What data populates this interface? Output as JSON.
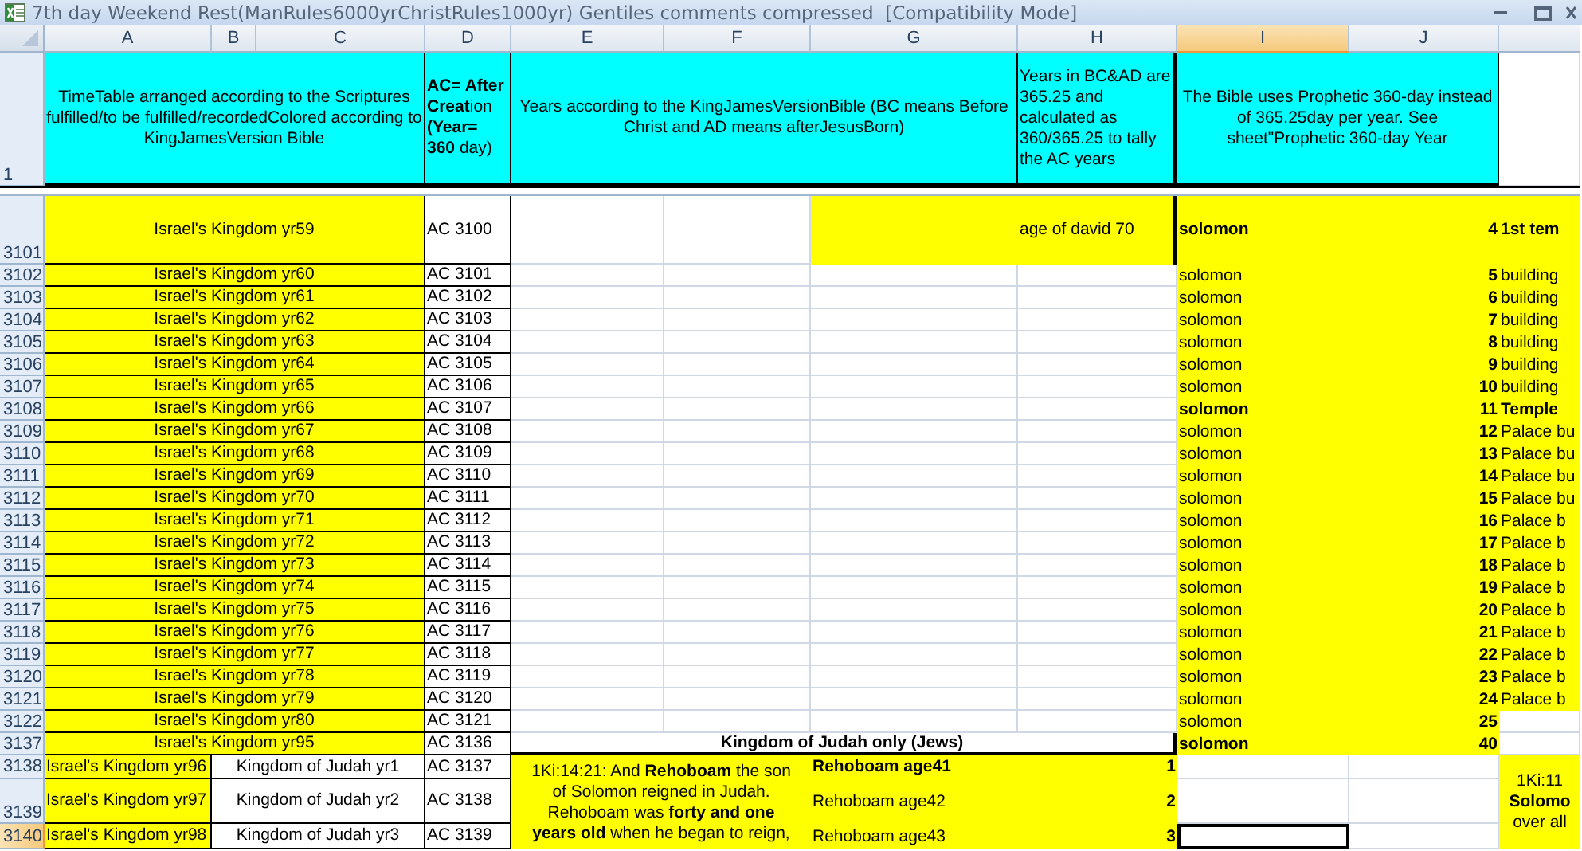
{
  "window": {
    "title": "7th day Weekend Rest(ManRules6000yrChristRules1000yr) Gentiles comments compressed  [Compatibility Mode]"
  },
  "columns": [
    {
      "label": "A",
      "selected": false
    },
    {
      "label": "B",
      "selected": false
    },
    {
      "label": "C",
      "selected": false
    },
    {
      "label": "D",
      "selected": false
    },
    {
      "label": "E",
      "selected": false
    },
    {
      "label": "F",
      "selected": false
    },
    {
      "label": "G",
      "selected": false
    },
    {
      "label": "H",
      "selected": false
    },
    {
      "label": "I",
      "selected": true
    },
    {
      "label": "J",
      "selected": false
    }
  ],
  "rows": [
    {
      "number": "1",
      "selected": false,
      "cells": {
        "A:C": {
          "text": "TimeTable arranged according to the Scriptures fulfilled/to be fulfilled/recordedColored according to KingJamesVersion Bible",
          "color": "#00ffff"
        },
        "D": {
          "text": "**AC= After Creat**ion **(Year= 360** day)",
          "color": "#00ffff"
        },
        "E:G": {
          "text": "Years according to the KingJamesVersionBible (BC means Before Christ and AD means afterJesusBorn)",
          "color": "#00ffff"
        },
        "H": {
          "text": "Years in BC&AD are 365.25 and calculated as 360/365.25 to tally the AC years",
          "color": "#00ffff"
        },
        "I:J": {
          "text": "The Bible uses Prophetic 360-day instead of 365.25day per year. See sheet\"Prophetic 360-day Year",
          "color": "#00ffff"
        }
      }
    },
    {
      "number": "3101",
      "selected": false,
      "cells": {
        "A:C": {
          "text": "Israel's Kingdom yr59",
          "color": "#ffff00"
        },
        "D": {
          "text": "AC 3100"
        },
        "G": {
          "color": "#ffff00"
        },
        "H": {
          "text": "age of david 70",
          "color": "#ffff00"
        },
        "I": {
          "text": "solomon",
          "color": "#ffff00",
          "bold": true
        },
        "J": {
          "text": "4",
          "color": "#ffff00",
          "bold": true
        },
        "K": {
          "text": "1st tem",
          "color": "#ffff00",
          "bold": true
        }
      }
    },
    {
      "number": "3102",
      "selected": false,
      "cells": {
        "A:C": {
          "text": "Israel's Kingdom yr60",
          "color": "#ffff00"
        },
        "D": {
          "text": "AC 3101"
        },
        "I": {
          "text": "solomon",
          "color": "#ffff00",
          "bold": false
        },
        "J": {
          "text": "5",
          "color": "#ffff00",
          "bold": true
        },
        "K": {
          "text": "building",
          "color": "#ffff00",
          "bold": false
        }
      }
    },
    {
      "number": "3103",
      "selected": false,
      "cells": {
        "A:C": {
          "text": "Israel's Kingdom yr61",
          "color": "#ffff00"
        },
        "D": {
          "text": "AC 3102"
        },
        "I": {
          "text": "solomon",
          "color": "#ffff00",
          "bold": false
        },
        "J": {
          "text": "6",
          "color": "#ffff00",
          "bold": true
        },
        "K": {
          "text": "building",
          "color": "#ffff00",
          "bold": false
        }
      }
    },
    {
      "number": "3104",
      "selected": false,
      "cells": {
        "A:C": {
          "text": "Israel's Kingdom yr62",
          "color": "#ffff00"
        },
        "D": {
          "text": "AC 3103"
        },
        "I": {
          "text": "solomon",
          "color": "#ffff00",
          "bold": false
        },
        "J": {
          "text": "7",
          "color": "#ffff00",
          "bold": true
        },
        "K": {
          "text": "building",
          "color": "#ffff00",
          "bold": false
        }
      }
    },
    {
      "number": "3105",
      "selected": false,
      "cells": {
        "A:C": {
          "text": "Israel's Kingdom yr63",
          "color": "#ffff00"
        },
        "D": {
          "text": "AC 3104"
        },
        "I": {
          "text": "solomon",
          "color": "#ffff00",
          "bold": false
        },
        "J": {
          "text": "8",
          "color": "#ffff00",
          "bold": true
        },
        "K": {
          "text": "building",
          "color": "#ffff00",
          "bold": false
        }
      }
    },
    {
      "number": "3106",
      "selected": false,
      "cells": {
        "A:C": {
          "text": "Israel's Kingdom yr64",
          "color": "#ffff00"
        },
        "D": {
          "text": "AC 3105"
        },
        "I": {
          "text": "solomon",
          "color": "#ffff00",
          "bold": false
        },
        "J": {
          "text": "9",
          "color": "#ffff00",
          "bold": true
        },
        "K": {
          "text": "building",
          "color": "#ffff00",
          "bold": false
        }
      }
    },
    {
      "number": "3107",
      "selected": false,
      "cells": {
        "A:C": {
          "text": "Israel's Kingdom yr65",
          "color": "#ffff00"
        },
        "D": {
          "text": "AC 3106"
        },
        "I": {
          "text": "solomon",
          "color": "#ffff00",
          "bold": false
        },
        "J": {
          "text": "10",
          "color": "#ffff00",
          "bold": true
        },
        "K": {
          "text": "building",
          "color": "#ffff00",
          "bold": false
        }
      }
    },
    {
      "number": "3108",
      "selected": false,
      "cells": {
        "A:C": {
          "text": "Israel's Kingdom yr66",
          "color": "#ffff00"
        },
        "D": {
          "text": "AC 3107"
        },
        "I": {
          "text": "solomon",
          "color": "#ffff00",
          "bold": true
        },
        "J": {
          "text": "11",
          "color": "#ffff00",
          "bold": true
        },
        "K": {
          "text": "Temple",
          "color": "#ffff00",
          "bold": true
        }
      }
    },
    {
      "number": "3109",
      "selected": false,
      "cells": {
        "A:C": {
          "text": "Israel's Kingdom yr67",
          "color": "#ffff00"
        },
        "D": {
          "text": "AC 3108"
        },
        "I": {
          "text": "solomon",
          "color": "#ffff00",
          "bold": false
        },
        "J": {
          "text": "12",
          "color": "#ffff00",
          "bold": true
        },
        "K": {
          "text": "Palace bu",
          "color": "#ffff00",
          "bold": false
        }
      }
    },
    {
      "number": "3110",
      "selected": false,
      "cells": {
        "A:C": {
          "text": "Israel's Kingdom yr68",
          "color": "#ffff00"
        },
        "D": {
          "text": "AC 3109"
        },
        "I": {
          "text": "solomon",
          "color": "#ffff00",
          "bold": false
        },
        "J": {
          "text": "13",
          "color": "#ffff00",
          "bold": true
        },
        "K": {
          "text": "Palace bu",
          "color": "#ffff00",
          "bold": false
        }
      }
    },
    {
      "number": "3111",
      "selected": false,
      "cells": {
        "A:C": {
          "text": "Israel's Kingdom yr69",
          "color": "#ffff00"
        },
        "D": {
          "text": "AC 3110"
        },
        "I": {
          "text": "solomon",
          "color": "#ffff00",
          "bold": false
        },
        "J": {
          "text": "14",
          "color": "#ffff00",
          "bold": true
        },
        "K": {
          "text": "Palace bu",
          "color": "#ffff00",
          "bold": false
        }
      }
    },
    {
      "number": "3112",
      "selected": false,
      "cells": {
        "A:C": {
          "text": "Israel's Kingdom yr70",
          "color": "#ffff00"
        },
        "D": {
          "text": "AC 3111"
        },
        "I": {
          "text": "solomon",
          "color": "#ffff00",
          "bold": false
        },
        "J": {
          "text": "15",
          "color": "#ffff00",
          "bold": true
        },
        "K": {
          "text": "Palace bu",
          "color": "#ffff00",
          "bold": false
        }
      }
    },
    {
      "number": "3113",
      "selected": false,
      "cells": {
        "A:C": {
          "text": "Israel's Kingdom yr71",
          "color": "#ffff00"
        },
        "D": {
          "text": "AC 3112"
        },
        "I": {
          "text": "solomon",
          "color": "#ffff00",
          "bold": false
        },
        "J": {
          "text": "16",
          "color": "#ffff00",
          "bold": true
        },
        "K": {
          "text": "Palace b",
          "color": "#ffff00",
          "bold": false
        }
      }
    },
    {
      "number": "3114",
      "selected": false,
      "cells": {
        "A:C": {
          "text": "Israel's Kingdom yr72",
          "color": "#ffff00"
        },
        "D": {
          "text": "AC 3113"
        },
        "I": {
          "text": "solomon",
          "color": "#ffff00",
          "bold": false
        },
        "J": {
          "text": "17",
          "color": "#ffff00",
          "bold": true
        },
        "K": {
          "text": "Palace b",
          "color": "#ffff00",
          "bold": false
        }
      }
    },
    {
      "number": "3115",
      "selected": false,
      "cells": {
        "A:C": {
          "text": "Israel's Kingdom yr73",
          "color": "#ffff00"
        },
        "D": {
          "text": "AC 3114"
        },
        "I": {
          "text": "solomon",
          "color": "#ffff00",
          "bold": false
        },
        "J": {
          "text": "18",
          "color": "#ffff00",
          "bold": true
        },
        "K": {
          "text": "Palace b",
          "color": "#ffff00",
          "bold": false
        }
      }
    },
    {
      "number": "3116",
      "selected": false,
      "cells": {
        "A:C": {
          "text": "Israel's Kingdom yr74",
          "color": "#ffff00"
        },
        "D": {
          "text": "AC 3115"
        },
        "I": {
          "text": "solomon",
          "color": "#ffff00",
          "bold": false
        },
        "J": {
          "text": "19",
          "color": "#ffff00",
          "bold": true
        },
        "K": {
          "text": "Palace b",
          "color": "#ffff00",
          "bold": false
        }
      }
    },
    {
      "number": "3117",
      "selected": false,
      "cells": {
        "A:C": {
          "text": "Israel's Kingdom yr75",
          "color": "#ffff00"
        },
        "D": {
          "text": "AC 3116"
        },
        "I": {
          "text": "solomon",
          "color": "#ffff00",
          "bold": false
        },
        "J": {
          "text": "20",
          "color": "#ffff00",
          "bold": true
        },
        "K": {
          "text": "Palace b",
          "color": "#ffff00",
          "bold": false
        }
      }
    },
    {
      "number": "3118",
      "selected": false,
      "cells": {
        "A:C": {
          "text": "Israel's Kingdom yr76",
          "color": "#ffff00"
        },
        "D": {
          "text": "AC 3117"
        },
        "I": {
          "text": "solomon",
          "color": "#ffff00",
          "bold": false
        },
        "J": {
          "text": "21",
          "color": "#ffff00",
          "bold": true
        },
        "K": {
          "text": "Palace b",
          "color": "#ffff00",
          "bold": false
        }
      }
    },
    {
      "number": "3119",
      "selected": false,
      "cells": {
        "A:C": {
          "text": "Israel's Kingdom yr77",
          "color": "#ffff00"
        },
        "D": {
          "text": "AC 3118"
        },
        "I": {
          "text": "solomon",
          "color": "#ffff00",
          "bold": false
        },
        "J": {
          "text": "22",
          "color": "#ffff00",
          "bold": true
        },
        "K": {
          "text": "Palace b",
          "color": "#ffff00",
          "bold": false
        }
      }
    },
    {
      "number": "3120",
      "selected": false,
      "cells": {
        "A:C": {
          "text": "Israel's Kingdom yr78",
          "color": "#ffff00"
        },
        "D": {
          "text": "AC 3119"
        },
        "I": {
          "text": "solomon",
          "color": "#ffff00",
          "bold": false
        },
        "J": {
          "text": "23",
          "color": "#ffff00",
          "bold": true
        },
        "K": {
          "text": "Palace b",
          "color": "#ffff00",
          "bold": false
        }
      }
    },
    {
      "number": "3121",
      "selected": false,
      "cells": {
        "A:C": {
          "text": "Israel's Kingdom yr79",
          "color": "#ffff00"
        },
        "D": {
          "text": "AC 3120"
        },
        "I": {
          "text": "solomon",
          "color": "#ffff00",
          "bold": false
        },
        "J": {
          "text": "24",
          "color": "#ffff00",
          "bold": true
        },
        "K": {
          "text": "Palace b",
          "color": "#ffff00",
          "bold": false
        }
      }
    },
    {
      "number": "3122",
      "selected": false,
      "cells": {
        "A:C": {
          "text": "Israel's Kingdom yr80",
          "color": "#ffff00"
        },
        "D": {
          "text": "AC 3121"
        },
        "I": {
          "text": "solomon",
          "color": "#ffff00",
          "bold": false
        },
        "J": {
          "text": "25",
          "color": "#ffff00",
          "bold": true
        }
      }
    },
    {
      "number": "3137",
      "selected": false,
      "cells": {
        "A:C": {
          "text": "Israel's Kingdom yr95",
          "color": "#ffff00"
        },
        "D": {
          "text": "AC 3136"
        },
        "E:H": {
          "text": "Kingdom of Judah only (Jews)",
          "bold": true
        },
        "I": {
          "text": "solomon",
          "color": "#ffff00",
          "bold": true
        },
        "J": {
          "text": "40",
          "color": "#ffff00",
          "bold": true
        }
      }
    },
    {
      "number": "3138",
      "selected": false,
      "cells": {
        "A": {
          "text": "Israel's Kingdom yr96",
          "color": "#ffff00"
        },
        "B:C": {
          "text": "Kingdom of Judah yr1"
        },
        "D": {
          "text": "AC 3137"
        },
        "E:F*3": {
          "text": "1Ki:14:21: And **Rehoboam** the son\nof Solomon reigned in Judah.\nRehoboam was **forty and one**\n**years old** when he began to reign,",
          "color": "#ffff00"
        },
        "G": {
          "text": "Rehoboam age41",
          "color": "#ffff00",
          "bold": true
        },
        "H": {
          "text": "1",
          "color": "#ffff00",
          "bold": true
        },
        "K*3": {
          "text": "1Ki:11\n**Solomo**\nover all",
          "color": "#ffff00"
        }
      }
    },
    {
      "number": "3139",
      "selected": false,
      "cells": {
        "A": {
          "text": "Israel's Kingdom yr97",
          "color": "#ffff00"
        },
        "B:C": {
          "text": "Kingdom of Judah yr2"
        },
        "D": {
          "text": "AC 3138"
        },
        "G": {
          "text": "Rehoboam age42",
          "color": "#ffff00",
          "bold": false
        },
        "H": {
          "text": "2",
          "color": "#ffff00",
          "bold": true
        }
      }
    },
    {
      "number": "3140",
      "selected": true,
      "cells": {
        "A": {
          "text": "Israel's Kingdom yr98",
          "color": "#ffff00"
        },
        "B:C": {
          "text": "Kingdom of Judah yr3"
        },
        "D": {
          "text": "AC 3139"
        },
        "G": {
          "text": "Rehoboam age43",
          "color": "#ffff00",
          "bold": false
        },
        "H": {
          "text": "3",
          "color": "#ffff00",
          "bold": true
        }
      }
    }
  ]
}
